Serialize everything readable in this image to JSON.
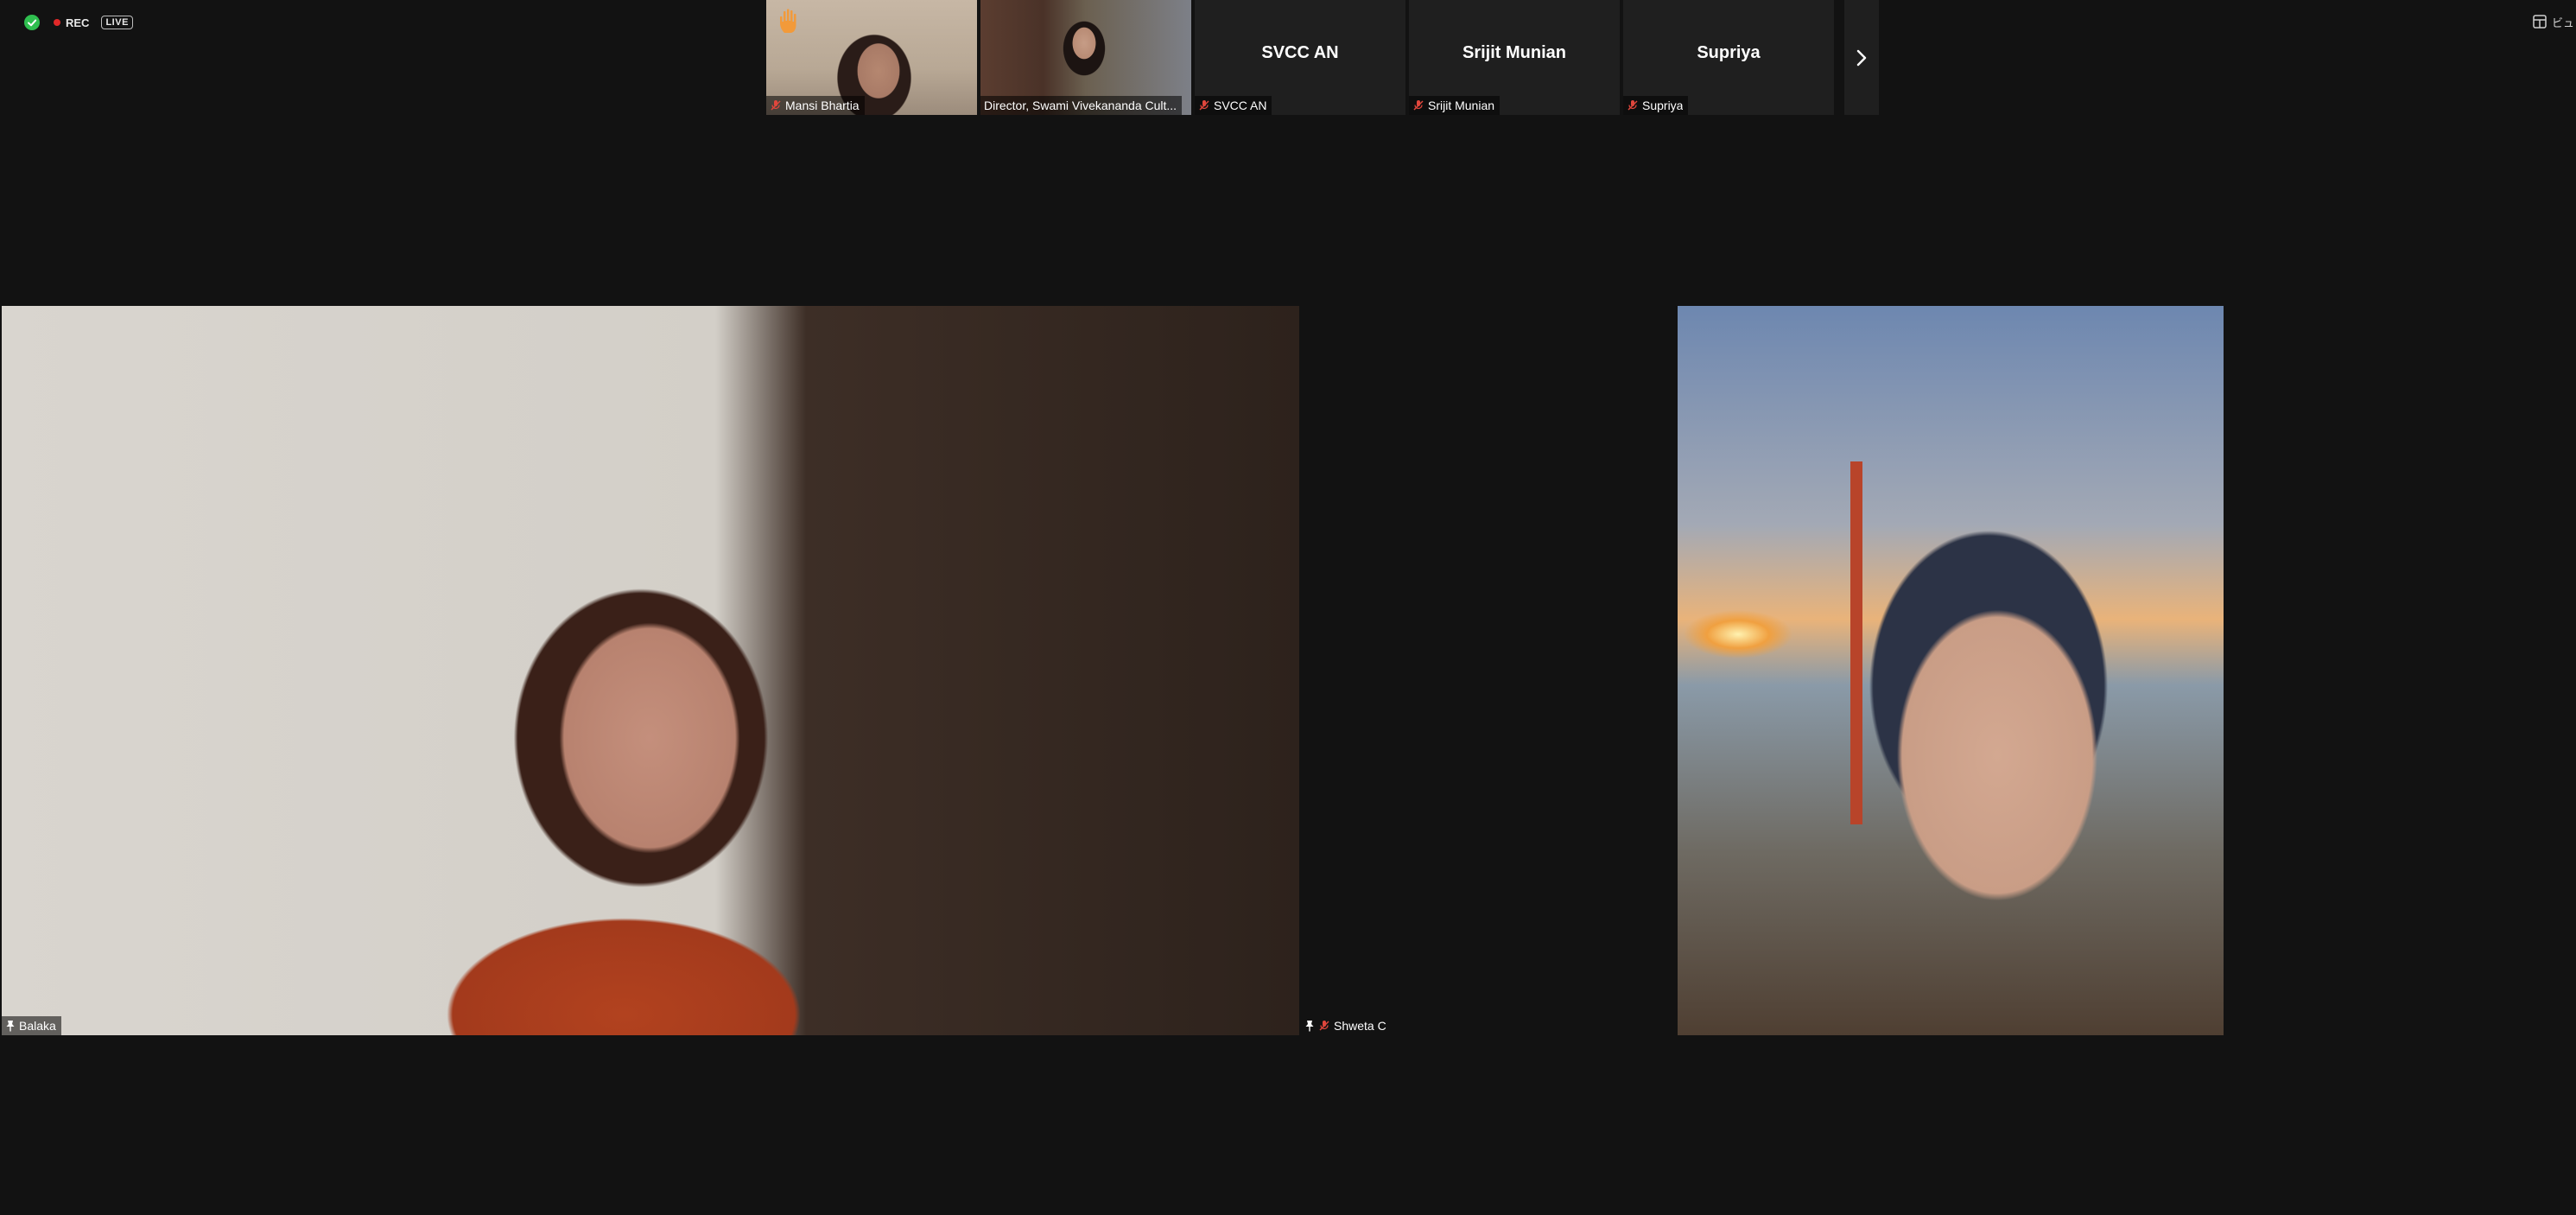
{
  "status": {
    "rec_label": "REC",
    "live_label": "LIVE"
  },
  "view_button": {
    "label": "ビュ"
  },
  "filmstrip": {
    "tiles": [
      {
        "name": "Mansi Bhartia",
        "has_video": true,
        "raised_hand": true
      },
      {
        "name": "Director, Swami Vivekananda Cult...",
        "has_video": true,
        "raised_hand": false
      },
      {
        "name": "SVCC AN",
        "display": "SVCC AN",
        "has_video": false,
        "muted": true
      },
      {
        "name": "Srijit Munian",
        "display": "Srijit Munian",
        "has_video": false,
        "muted": true
      },
      {
        "name": "Supriya",
        "display": "Supriya",
        "has_video": false,
        "muted": true
      }
    ]
  },
  "main": {
    "left_speaker": {
      "name": "Balaka",
      "pinned": true
    },
    "right_speaker": {
      "name": "Shweta C",
      "pinned": true,
      "muted": true
    }
  },
  "colors": {
    "background": "#121212",
    "tile_bg": "#1f1f1f",
    "shield": "#2fbf4f",
    "rec_dot": "#e02828",
    "muted_mic": "#e0463c",
    "raised_hand": "#f29a3a"
  }
}
